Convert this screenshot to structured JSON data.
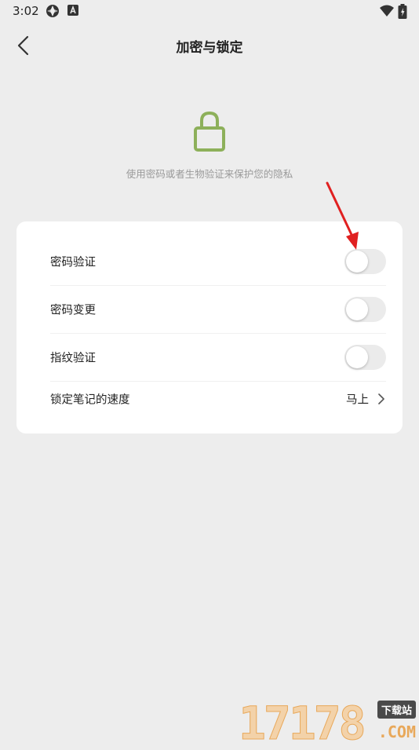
{
  "status_bar": {
    "time": "3:02",
    "icons": [
      "app-notification-icon",
      "font-a-icon",
      "wifi-icon",
      "battery-icon"
    ]
  },
  "header": {
    "title": "加密与锁定"
  },
  "hero": {
    "icon": "lock-icon",
    "icon_color": "#8db05a",
    "subtitle": "使用密码或者生物验证来保护您的隐私"
  },
  "settings": {
    "password_verify": {
      "label": "密码验证",
      "enabled": false
    },
    "password_change": {
      "label": "密码变更",
      "enabled": false
    },
    "fingerprint_verify": {
      "label": "指纹验证",
      "enabled": false
    },
    "lock_speed": {
      "label": "锁定笔记的速度",
      "value": "马上"
    }
  },
  "annotation": {
    "color": "#e02020"
  },
  "watermark": {
    "digits": "17178",
    "badge": "下载站",
    "suffix": ".COM"
  }
}
